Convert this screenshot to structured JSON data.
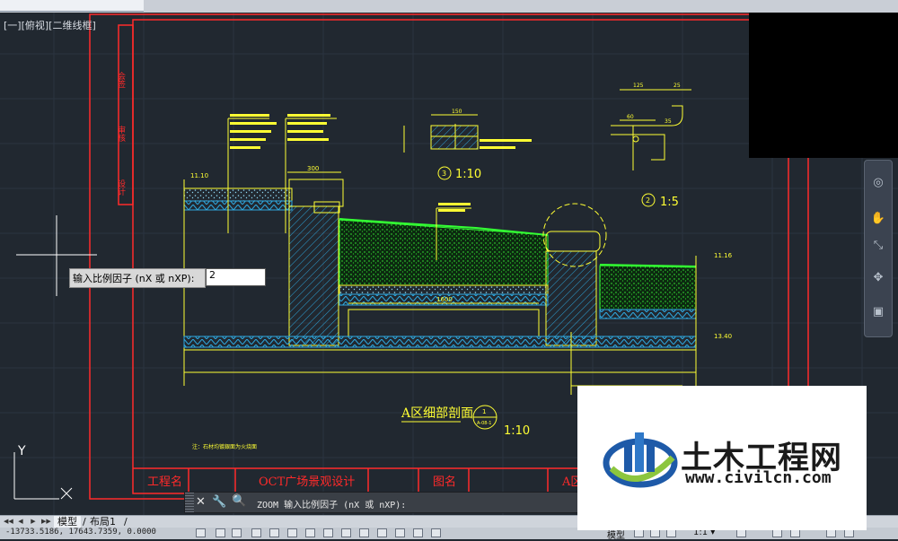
{
  "window": {
    "title": ""
  },
  "viewport": {
    "label": "[一][俯视][二维线框]"
  },
  "drawing": {
    "title_block": {
      "project_label": "工程名",
      "project_name": "OCT广场景观设计",
      "drawing_label": "图名",
      "drawing_name_partial": "A区"
    },
    "main_section": {
      "title": "A区细部剖面",
      "scale": "1:10",
      "callout": "1",
      "callout_sub": "A-08-1"
    },
    "detail_3": {
      "title": "3",
      "scale": "1:10"
    },
    "detail_2": {
      "title": "2",
      "scale": "1:5"
    },
    "note": "注：石材均镀銀面为火烧面",
    "dims": {
      "d1": "300",
      "d2": "150",
      "d3": "1600",
      "d4": "125",
      "d5": "25",
      "d6": "60",
      "d7": "35"
    },
    "levels": {
      "l1": "11.16",
      "l2": "13.40",
      "l3": "11.10"
    },
    "side_labels": [
      "会签",
      "审核",
      "设计"
    ],
    "ucs": {
      "y": "Y",
      "x": "X"
    }
  },
  "prompt": {
    "label": "输入比例因子 (nX 或 nXP):",
    "value": "2"
  },
  "command_line": {
    "text": "ZOOM 输入比例因子 (nX 或 nXP):"
  },
  "layout_tabs": {
    "tabs": [
      "模型",
      "布局1"
    ],
    "slash": "/"
  },
  "status": {
    "coords": "-13733.5186, 17643.7359, 0.0000",
    "model": "模型",
    "scale": "1:1 ▾"
  },
  "navbar": {
    "icons": [
      "steering-wheel-icon",
      "pan-icon",
      "zoom-extents-icon",
      "orbit-icon",
      "showmotion-icon"
    ]
  },
  "watermark": {
    "name": "土木工程网",
    "url": "www.civilcn.com"
  },
  "colors": {
    "background": "#212830",
    "frame_red": "#ff2a2a",
    "yellow": "#ffff33",
    "green": "#33ff33",
    "cyan": "#33ccff"
  }
}
